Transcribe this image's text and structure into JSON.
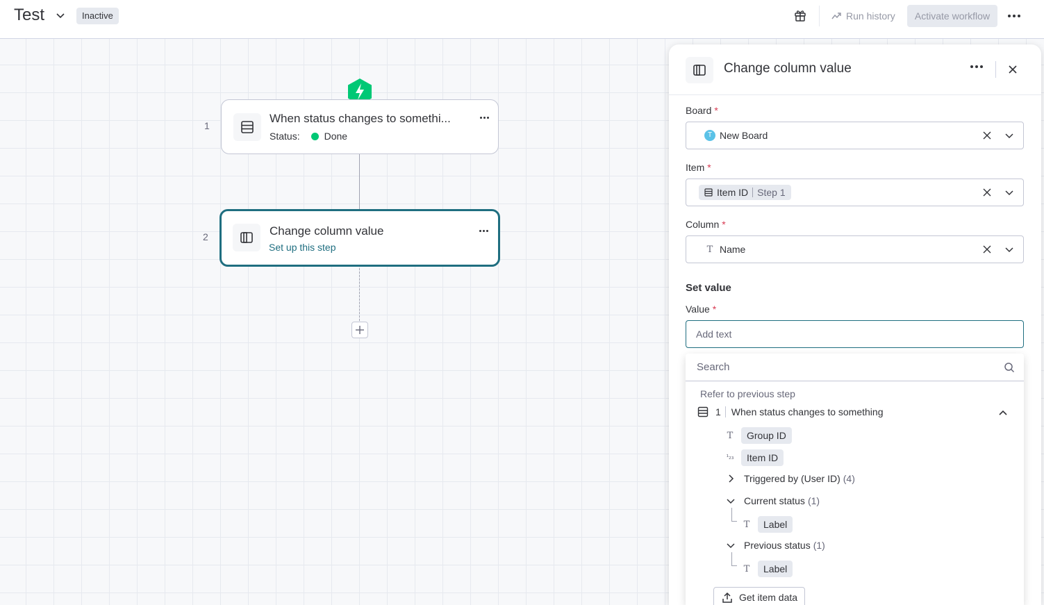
{
  "header": {
    "title": "Test",
    "status": "Inactive",
    "run_history": "Run history",
    "activate": "Activate workflow"
  },
  "canvas": {
    "steps": [
      {
        "num": "1",
        "title": "When status changes to somethi...",
        "status_label": "Status:",
        "status_value": "Done",
        "status_color": "#00c875"
      },
      {
        "num": "2",
        "title": "Change column value",
        "subtitle": "Set up this step"
      }
    ],
    "trigger_color": "#00c875",
    "active_border": "#1f6e80"
  },
  "panel": {
    "title": "Change column value",
    "board_label": "Board",
    "board_value": "New Board",
    "board_avatar": "T",
    "item_label": "Item",
    "item_value": "Item ID",
    "item_step": "Step 1",
    "column_label": "Column",
    "column_value": "Name",
    "section": "Set value",
    "value_label": "Value",
    "value_placeholder": "Add text",
    "required_mark": "*"
  },
  "dropdown": {
    "search_placeholder": "Search",
    "section": "Refer to previous step",
    "step_num": "1",
    "step_title": "When status changes to something",
    "items": {
      "group_id": "Group ID",
      "item_id": "Item ID",
      "triggered_by": "Triggered by (User ID)",
      "triggered_by_count": "(4)",
      "current_status": "Current status",
      "current_status_count": "(1)",
      "current_label": "Label",
      "previous_status": "Previous status",
      "previous_status_count": "(1)",
      "previous_label": "Label"
    },
    "get_item_data": "Get item data"
  }
}
